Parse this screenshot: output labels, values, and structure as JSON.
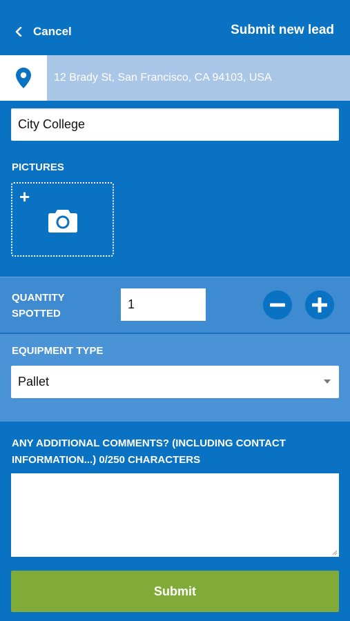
{
  "header": {
    "cancel_label": "Cancel",
    "title": "Submit new lead"
  },
  "location": {
    "icon": "map-pin-icon",
    "address": "12 Brady St, San Francisco, CA 94103, USA"
  },
  "lead_name": {
    "value": "City College"
  },
  "pictures": {
    "label": "PICTURES",
    "add_symbol": "+",
    "icon": "camera-icon"
  },
  "quantity": {
    "label": "QUANTITY SPOTTED",
    "value": "1",
    "decrement_icon": "minus-circle-icon",
    "increment_icon": "plus-circle-icon"
  },
  "equipment": {
    "label": "EQUIPMENT TYPE",
    "selected": "Pallet"
  },
  "comments": {
    "label": "ANY ADDITIONAL COMMENTS? (INCLUDING CONTACT INFORMATION...) 0/250 CHARACTERS",
    "value": ""
  },
  "submit_label": "Submit",
  "colors": {
    "primary_blue": "#0a72c2",
    "section_blue": "#4a93d6",
    "location_bar": "#a9c6e6",
    "submit_green": "#80ab38"
  }
}
